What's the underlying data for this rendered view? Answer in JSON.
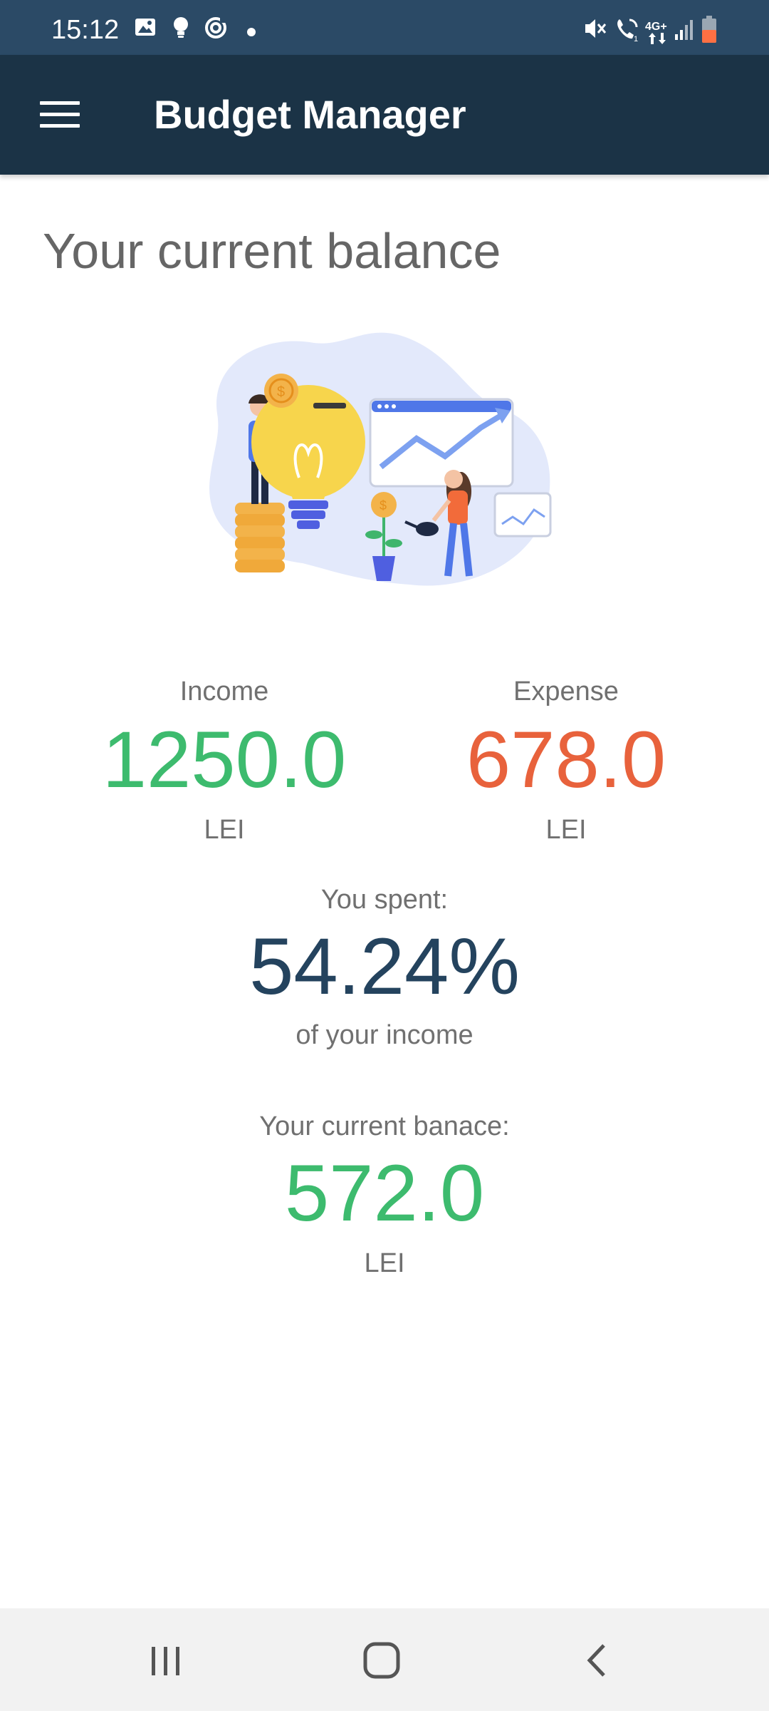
{
  "status_bar": {
    "time": "15:12",
    "network_label": "4G+",
    "icons": [
      "image-icon",
      "bulb-icon",
      "sync-icon",
      "dot-icon",
      "mute-icon",
      "wifi-call-icon",
      "signal-icon",
      "battery-icon"
    ],
    "battery_color": "#ff7043"
  },
  "app_bar": {
    "title": "Budget Manager",
    "background": "#1b3346"
  },
  "page": {
    "heading": "Your current balance"
  },
  "income": {
    "label": "Income",
    "value": "1250.0",
    "unit": "LEI",
    "color": "#3dbb6e"
  },
  "expense": {
    "label": "Expense",
    "value": "678.0",
    "unit": "LEI",
    "color": "#e8623c"
  },
  "spent": {
    "label": "You spent:",
    "value": "54.24%",
    "suffix": "of your income",
    "color": "#24435e"
  },
  "balance": {
    "label": "Your current banace:",
    "value": "572.0",
    "unit": "LEI",
    "color": "#3dbb6e"
  },
  "nav": {
    "buttons": [
      "recent-apps-icon",
      "home-icon",
      "back-icon"
    ]
  }
}
